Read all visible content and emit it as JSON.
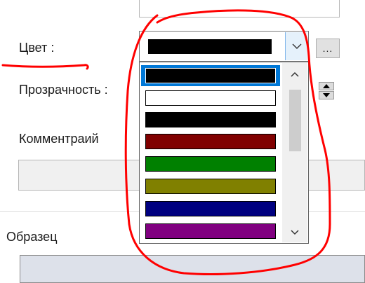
{
  "form": {
    "color_label": "Цвет :",
    "transparency_label": "Прозрачность :",
    "comment_label": "Комментраий",
    "sample_label": "Образец",
    "more_button_label": "..."
  },
  "color_combo": {
    "selected_color": "#000000",
    "options": [
      {
        "color": "#000000",
        "selected": true
      },
      {
        "color": "#ffffff"
      },
      {
        "color": "#000000"
      },
      {
        "color": "#800000"
      },
      {
        "color": "#008000"
      },
      {
        "color": "#808000"
      },
      {
        "color": "#000080"
      },
      {
        "color": "#800080"
      }
    ]
  },
  "annotation": {
    "color": "#ff0000"
  }
}
